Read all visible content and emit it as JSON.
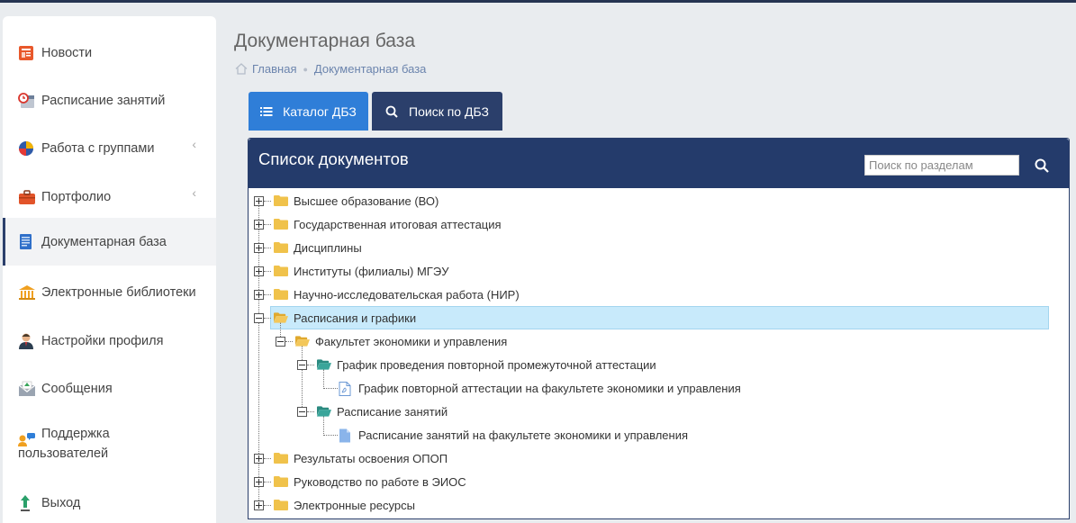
{
  "sidebar": {
    "items": [
      {
        "label": "Новости",
        "icon": "newspaper-icon"
      },
      {
        "label": "Расписание занятий",
        "icon": "schedule-icon"
      },
      {
        "label": "Работа с группами",
        "icon": "groups-icon",
        "has_submenu": true
      },
      {
        "label": "Портфолио",
        "icon": "briefcase-icon",
        "has_submenu": true
      },
      {
        "label": "Документарная база",
        "icon": "document-icon",
        "active": true
      },
      {
        "label": "Электронные библиотеки",
        "icon": "library-icon"
      },
      {
        "label": "Настройки профиля",
        "icon": "user-settings-icon"
      },
      {
        "label": "Сообщения",
        "icon": "mail-icon"
      },
      {
        "label_line1": "Поддержка",
        "label_line2": "пользователей",
        "icon": "support-icon"
      },
      {
        "label": "Выход",
        "icon": "logout-icon"
      }
    ]
  },
  "header": {
    "title": "Документарная база",
    "breadcrumb": [
      "Главная",
      "Документарная база"
    ]
  },
  "tabs": [
    {
      "label": "Каталог ДБЗ",
      "icon": "list-icon"
    },
    {
      "label": "Поиск по ДБЗ",
      "icon": "search-icon",
      "active": true
    }
  ],
  "panel": {
    "title": "Список документов",
    "search_placeholder": "Поиск по разделам"
  },
  "tree": [
    {
      "label": "Высшее образование (ВО)",
      "state": "collapsed"
    },
    {
      "label": "Государственная итоговая аттестация",
      "state": "collapsed"
    },
    {
      "label": "Дисциплины",
      "state": "collapsed"
    },
    {
      "label": "Институты (филиалы) МГЭУ",
      "state": "collapsed"
    },
    {
      "label": "Научно-исследовательская работа (НИР)",
      "state": "collapsed"
    },
    {
      "label": "Расписания и графики",
      "state": "expanded",
      "selected": true
    },
    {
      "label": "Факультет экономики и управления",
      "state": "expanded"
    },
    {
      "label": "График проведения повторной промежуточной аттестации",
      "state": "expanded"
    },
    {
      "label": "График повторной аттестации на факультете экономики и управления",
      "type": "pdf-file"
    },
    {
      "label": "Расписание занятий",
      "state": "expanded"
    },
    {
      "label": "Расписание занятий на факультете экономики и управления",
      "type": "file"
    },
    {
      "label": "Результаты освоения ОПОП",
      "state": "collapsed"
    },
    {
      "label": "Руководство по работе в ЭИОС",
      "state": "collapsed"
    },
    {
      "label": "Электронные ресурсы",
      "state": "collapsed"
    }
  ],
  "colors": {
    "accent_dark": "#243b6b",
    "accent_blue": "#2f7ed8",
    "folder": "#f0c24b",
    "folder_open_teal": "#3aa59a",
    "selection": "#c8eafb"
  }
}
